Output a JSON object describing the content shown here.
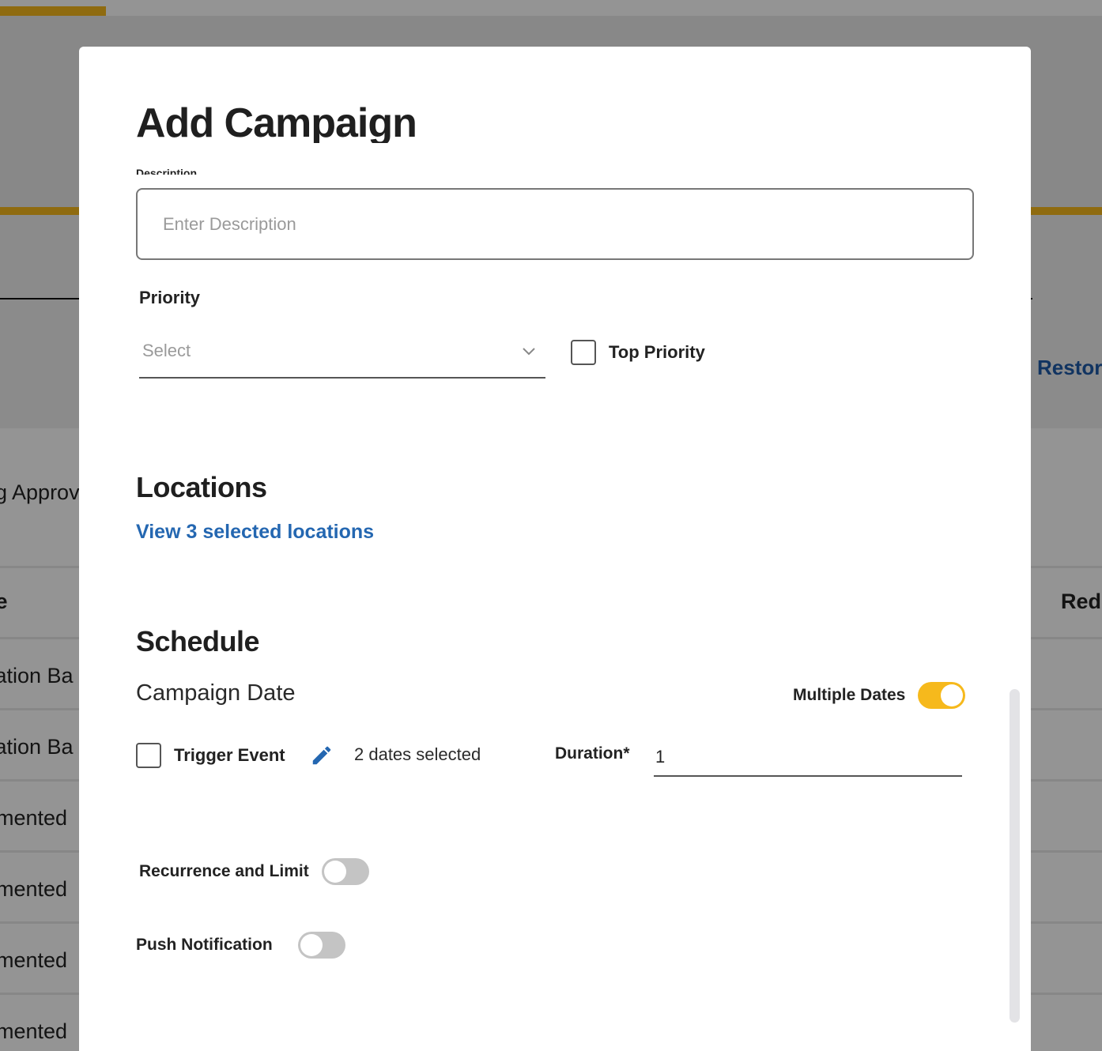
{
  "background": {
    "side_link": "Restor",
    "partial_text": "g Approv",
    "table_headers": {
      "left": "pe",
      "right": "Red"
    },
    "table_cells": [
      "cation Ba",
      "cation Ba",
      "gmented",
      "gmented",
      "gmented",
      "gmented"
    ]
  },
  "modal": {
    "title": "Add Campaign",
    "description": {
      "label": "Description",
      "placeholder": "Enter Description",
      "value": ""
    },
    "priority": {
      "label": "Priority",
      "select_placeholder": "Select",
      "top_priority_label": "Top Priority",
      "top_priority_checked": false
    },
    "locations": {
      "title": "Locations",
      "link_text": "View 3 selected locations"
    },
    "schedule": {
      "title": "Schedule",
      "campaign_date_label": "Campaign Date",
      "multiple_dates_label": "Multiple Dates",
      "multiple_dates_on": true,
      "trigger_event_label": "Trigger Event",
      "trigger_event_checked": false,
      "dates_selected": "2 dates selected",
      "duration_label": "Duration*",
      "duration_value": "1",
      "recurrence_label": "Recurrence and Limit",
      "recurrence_on": false,
      "push_label": "Push Notification",
      "push_on": false
    }
  },
  "colors": {
    "accent": "#f6b91c",
    "link": "#2467b1",
    "toggle_off": "#c4c4c4"
  }
}
